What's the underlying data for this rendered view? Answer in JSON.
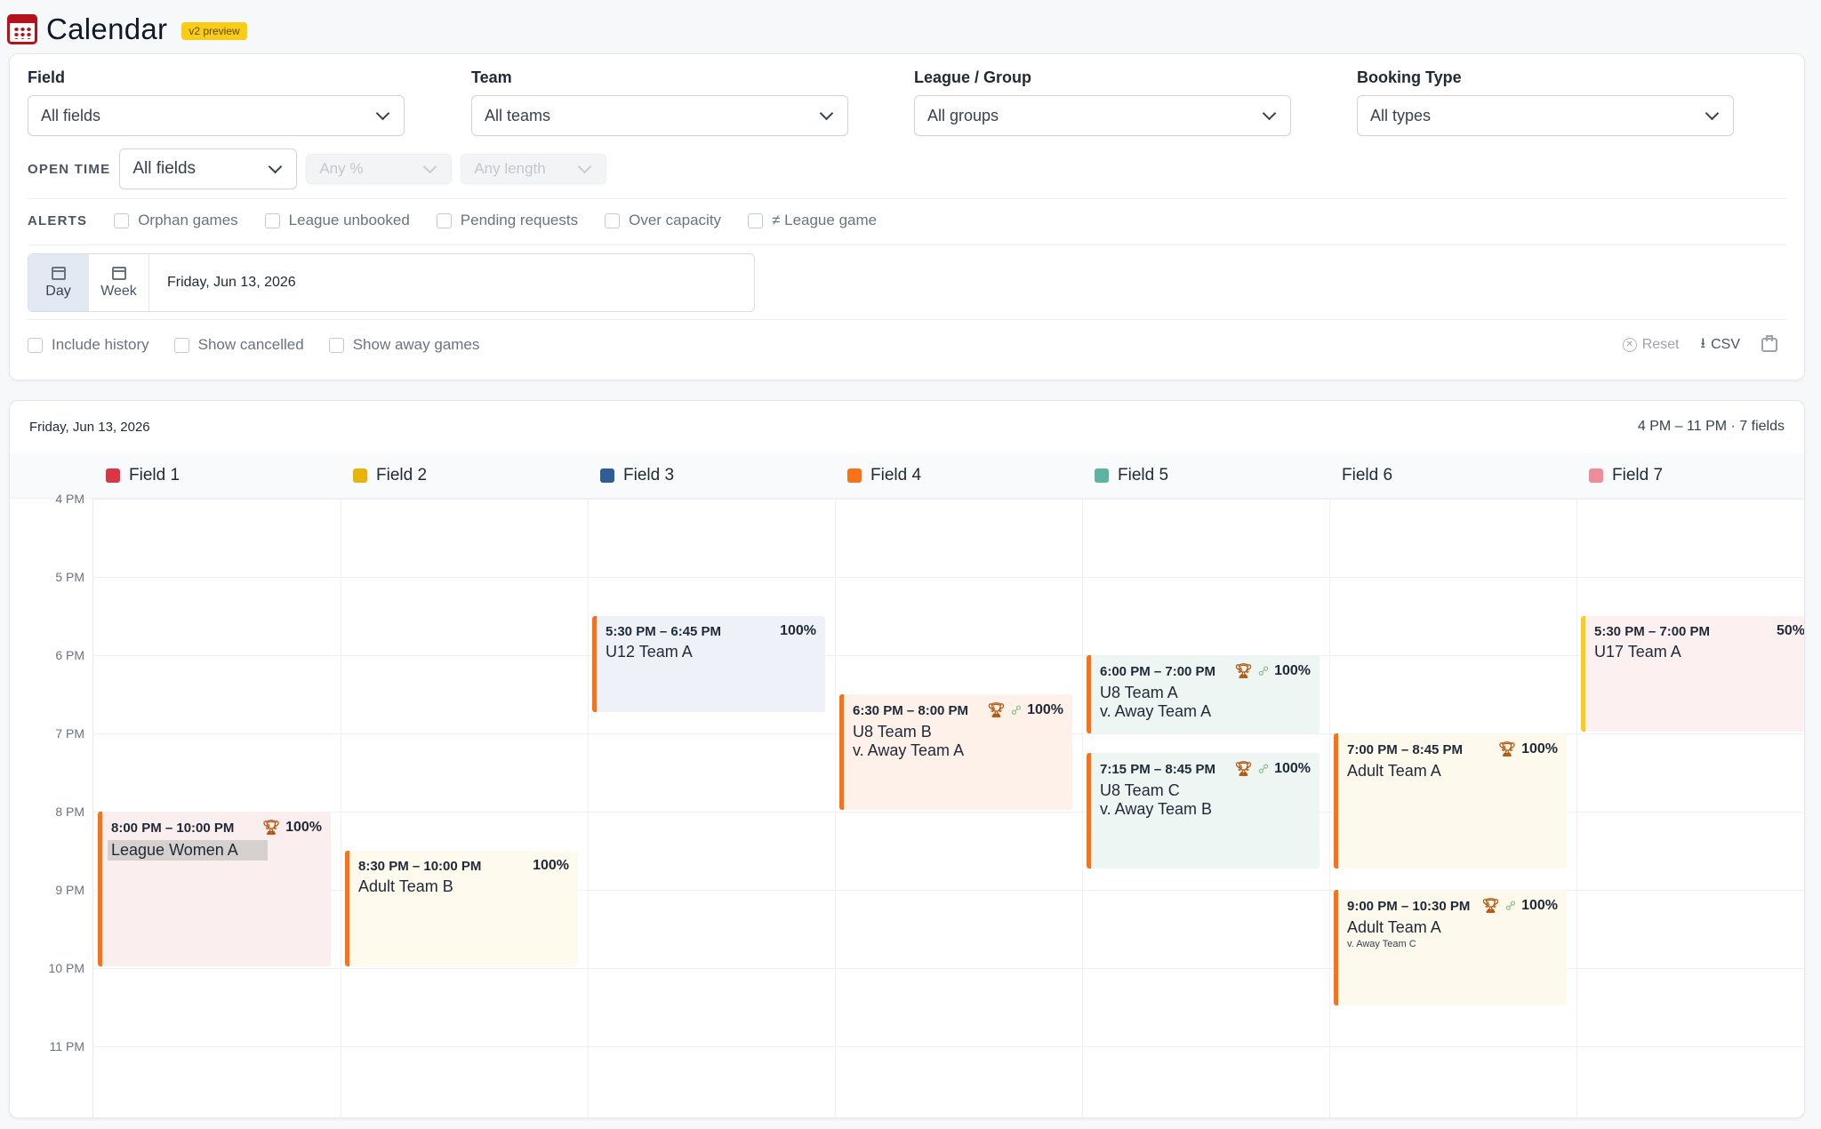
{
  "header": {
    "title": "Calendar",
    "badge": "v2 preview"
  },
  "filters": {
    "field": {
      "label": "Field",
      "value": "All fields"
    },
    "team": {
      "label": "Team",
      "value": "All teams"
    },
    "league": {
      "label": "League / Group",
      "value": "All groups"
    },
    "booking": {
      "label": "Booking Type",
      "value": "All types"
    }
  },
  "open_time": {
    "label": "OPEN TIME",
    "value": "All fields",
    "percent_placeholder": "Any %",
    "length_placeholder": "Any length"
  },
  "alerts": {
    "label": "ALERTS",
    "items": [
      "Orphan games",
      "League unbooked",
      "Pending requests",
      "Over capacity",
      "≠ League game"
    ]
  },
  "view": {
    "day": "Day",
    "week": "Week",
    "date": "Friday, Jun 13, 2026"
  },
  "options": {
    "history": "Include history",
    "cancelled": "Show cancelled",
    "away": "Show away games"
  },
  "actions": {
    "reset": "Reset",
    "csv": "CSV"
  },
  "calendar": {
    "date": "Friday, Jun 13, 2026",
    "summary": "4 PM – 11 PM · 7 fields",
    "fields": [
      {
        "name": "Field 1",
        "color": "#dc3545"
      },
      {
        "name": "Field 2",
        "color": "#eab308"
      },
      {
        "name": "Field 3",
        "color": "#2f5d9a"
      },
      {
        "name": "Field 4",
        "color": "#f97316"
      },
      {
        "name": "Field 5",
        "color": "#5fb3a3"
      },
      {
        "name": "Field 6",
        "color": ""
      },
      {
        "name": "Field 7",
        "color": "#f08c9a"
      }
    ],
    "hours": [
      "4 PM",
      "5 PM",
      "6 PM",
      "7 PM",
      "8 PM",
      "9 PM",
      "10 PM",
      "11 PM"
    ],
    "events": [
      {
        "time": "5:30 PM – 6:45 PM",
        "team": "U12 Team A",
        "opponent": "",
        "pct": "100%"
      },
      {
        "time": "6:30 PM – 8:00 PM",
        "team": "U8 Team B",
        "opponent": "v. Away Team A",
        "pct": "100%"
      },
      {
        "time": "6:00 PM – 7:00 PM",
        "team": "U8 Team A",
        "opponent": "v. Away Team A",
        "pct": "100%"
      },
      {
        "time": "7:15 PM – 8:45 PM",
        "team": "U8 Team C",
        "opponent": "v. Away Team B",
        "pct": "100%"
      },
      {
        "time": "5:30 PM – 7:00 PM",
        "team": "U17 Team A",
        "opponent": "",
        "pct": "50%"
      },
      {
        "time": "7:00 PM – 8:45 PM",
        "team": "Adult Team A",
        "opponent": "",
        "pct": "100%"
      },
      {
        "time": "8:00 PM – 10:00 PM",
        "team": "League Women A",
        "opponent": "",
        "pct": "100%"
      },
      {
        "time": "8:30 PM – 10:00 PM",
        "team": "Adult Team B",
        "opponent": "",
        "pct": "100%"
      },
      {
        "time": "9:00 PM – 10:30 PM",
        "team": "Adult Team A",
        "opponent": "v. Away Team C",
        "pct": "100%"
      }
    ]
  }
}
